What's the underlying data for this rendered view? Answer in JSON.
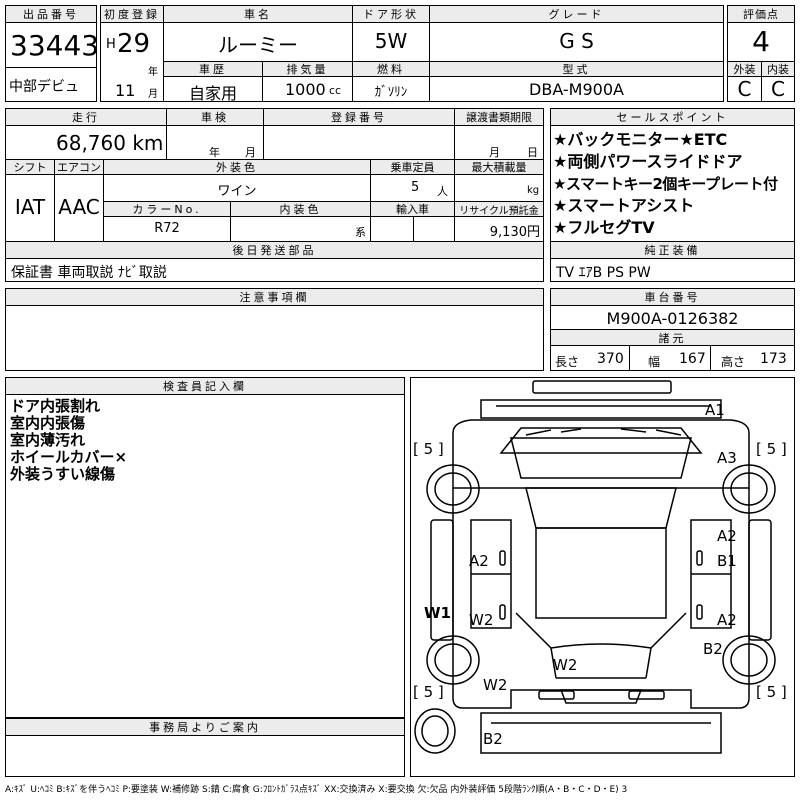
{
  "top": {
    "lot_label": "出品番号",
    "lot_number": "33443",
    "first_reg_label": "初度登録",
    "era": "H",
    "year": "29",
    "year_unit": "年",
    "month": "11",
    "month_unit": "月",
    "car_name_label": "車名",
    "car_name": "ルーミー",
    "door_label": "ドア形状",
    "door": "5W",
    "grade_label": "グレード",
    "grade": "G S",
    "score_label": "評価点",
    "score": "4",
    "debut": "中部デビュ",
    "history_label": "車歴",
    "history": "自家用",
    "displacement_label": "排気量",
    "displacement": "1000",
    "displacement_unit": "cc",
    "fuel_label": "燃料",
    "fuel": "ｶﾞｿﾘﾝ",
    "model_label": "型式",
    "model": "DBA-M900A",
    "exterior_label": "外装",
    "exterior": "C",
    "interior_label": "内装",
    "interior": "C"
  },
  "mid": {
    "mileage_label": "走行",
    "mileage": "68,760 km",
    "inspection_label": "車検",
    "insp_year": "年",
    "insp_month": "月",
    "reg_label": "登録番号",
    "transfer_label": "譲渡書類期限",
    "transfer_month": "月",
    "transfer_day": "日",
    "shift_label": "シフト",
    "shift": "IAT",
    "ac_label": "エアコン",
    "ac": "AAC",
    "color_label": "外装色",
    "color": "ワイン",
    "seats_label": "乗車定員",
    "seats": "5",
    "seats_unit": "人",
    "load_label": "最大積載量",
    "load_unit": "kg",
    "colorno_label": "カラーNo.",
    "colorno": "R72",
    "intcolor_label": "内装色",
    "intcolor_unit": "系",
    "import_label": "輸入車",
    "recycle_label": "リサイクル預託金",
    "recycle": "9,130円",
    "later_label": "後日発送部品",
    "later": "保証書 車両取説 ﾅﾋﾞ取説"
  },
  "sales": {
    "label": "セールスポイント",
    "points": [
      "★バックモニター★ETC",
      "★両側パワースライドドア",
      "★スマートキー2個キープレート付",
      "★スマートアシスト",
      "★フルセグTV"
    ],
    "equip_label": "純正装備",
    "equip": "TV ｴｱB PS PW"
  },
  "notes": {
    "label": "注意事項欄"
  },
  "chassis": {
    "label": "車台番号",
    "number": "M900A-0126382",
    "dim_label": "諸元",
    "len_label": "長さ",
    "len": "370",
    "width_label": "幅",
    "width": "167",
    "height_label": "高さ",
    "height": "173"
  },
  "inspector": {
    "label": "検査員記入欄",
    "lines": [
      "ドア内張割れ",
      "室内内張傷",
      "室内薄汚れ",
      "ホイールカバー×",
      "外装うすい線傷"
    ]
  },
  "office": {
    "label": "事務局よりご案内"
  },
  "diagram": {
    "tread_fl": "[ 5 ]",
    "tread_fr": "[ 5 ]",
    "tread_rl": "[ 5 ]",
    "tread_rr": "[ 5 ]",
    "a1": "A1",
    "a3": "A3",
    "a2_l": "A2",
    "a2_r1": "A2",
    "b1": "B1",
    "w1": "W1",
    "w2_l": "W2",
    "a2_r2": "A2",
    "b2_r": "B2",
    "w2_floor": "W2",
    "w2_rear": "W2",
    "b2_bottom": "B2"
  },
  "footer": "A:ｷｽﾞ U:ﾍｺﾐ B:ｷｽﾞを伴うﾍｺﾐ P:要塗装 W:補修跡 S:錆 C:腐食 G:ﾌﾛﾝﾄｶﾞﾗｽ点ｷｽﾞ XX:交換済み X:要交換 欠:欠品 内外装評価 5段階ﾗﾝｸ順(A・B・C・D・E) 3"
}
